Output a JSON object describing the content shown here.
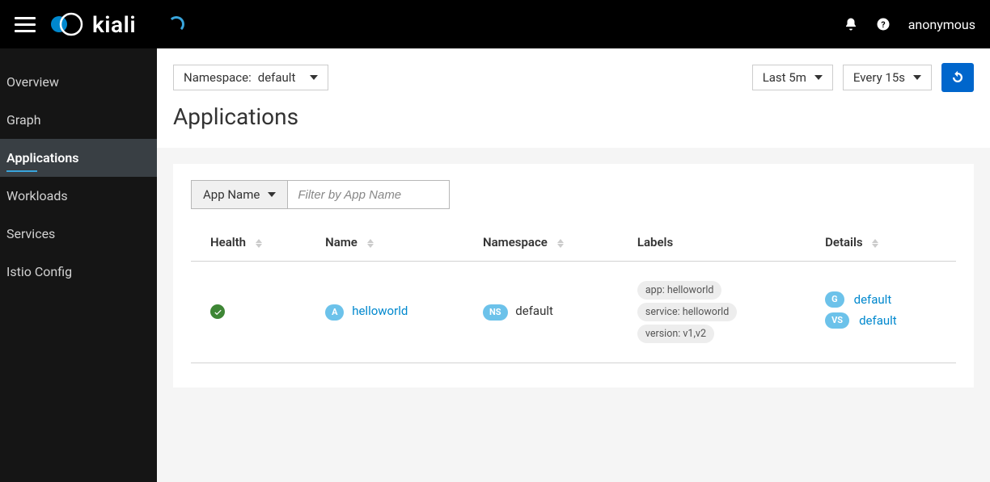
{
  "brand": "kiali",
  "user": "anonymous",
  "sidebar": {
    "items": [
      {
        "label": "Overview"
      },
      {
        "label": "Graph"
      },
      {
        "label": "Applications"
      },
      {
        "label": "Workloads"
      },
      {
        "label": "Services"
      },
      {
        "label": "Istio Config"
      }
    ],
    "activeIndex": 2
  },
  "header": {
    "namespaceLabel": "Namespace:",
    "namespaceValue": "default",
    "timeRange": "Last 5m",
    "refreshInterval": "Every 15s"
  },
  "page": {
    "title": "Applications"
  },
  "filter": {
    "dropdown": "App Name",
    "placeholder": "Filter by App Name"
  },
  "table": {
    "columns": {
      "health": "Health",
      "name": "Name",
      "namespace": "Namespace",
      "labels": "Labels",
      "details": "Details"
    },
    "row": {
      "namePill": "A",
      "name": "helloworld",
      "nsPill": "NS",
      "namespace": "default",
      "labels": [
        "app: helloworld",
        "service: helloworld",
        "version: v1,v2"
      ],
      "details": [
        {
          "pill": "G",
          "text": "default"
        },
        {
          "pill": "VS",
          "text": "default"
        }
      ]
    }
  }
}
